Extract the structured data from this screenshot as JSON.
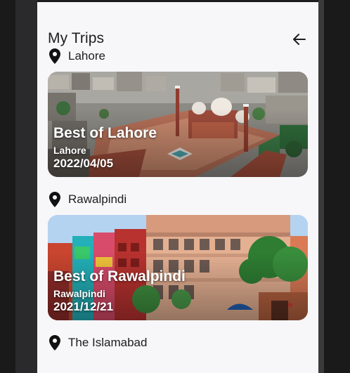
{
  "header": {
    "title": "My Trips",
    "back_icon": "arrow-left-icon"
  },
  "trips": [
    {
      "location": "Lahore",
      "card": {
        "title": "Best of Lahore",
        "city": "Lahore",
        "date": "2022/04/05"
      }
    },
    {
      "location": "Rawalpindi",
      "card": {
        "title": "Best of Rawalpindi",
        "city": "Rawalpindi",
        "date": "2021/12/21"
      }
    },
    {
      "location": "The Islamabad"
    }
  ],
  "colors": {
    "text": "#1d1d1f",
    "background": "#f7f7f9",
    "card_text": "#ffffff"
  }
}
